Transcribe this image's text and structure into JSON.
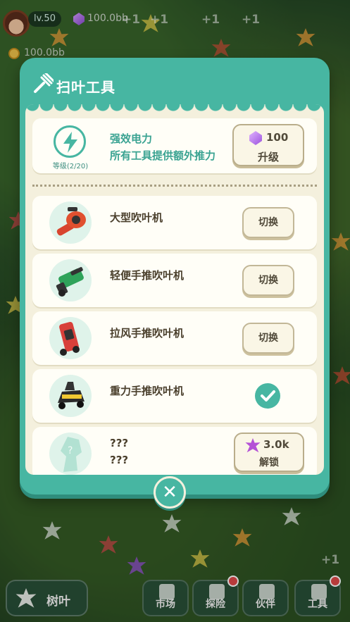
{
  "hud": {
    "level": "lv.50",
    "gems": "100.0bb",
    "coins": "100.0bb",
    "floating_bonus": "+1"
  },
  "modal": {
    "title": "扫叶工具",
    "upgrade": {
      "level_text": "等级(2/20)",
      "title": "强效电力",
      "description": "所有工具提供额外推力",
      "cost": "100",
      "button_label": "升级",
      "icon": "lightning-icon"
    },
    "tools": [
      {
        "name": "大型吹叶机",
        "action": "切换",
        "state": "available",
        "icon": "red-leaf-blower-icon"
      },
      {
        "name": "轻便手推吹叶机",
        "action": "切换",
        "state": "available",
        "icon": "green-push-blower-icon"
      },
      {
        "name": "拉风手推吹叶机",
        "action": "切换",
        "state": "available",
        "icon": "red-push-blower-icon"
      },
      {
        "name": "重力手推吹叶机",
        "action": "",
        "state": "selected",
        "icon": "black-push-blower-icon"
      }
    ],
    "locked_tool": {
      "name": "???",
      "subtitle": "???",
      "cost": "3.0k",
      "button_label": "解锁",
      "icon": "locked-silhouette-icon"
    },
    "close_icon": "close-icon"
  },
  "bottom_nav": {
    "leaves_label": "树叶",
    "items": [
      {
        "label": "市场",
        "icon": "scale-icon"
      },
      {
        "label": "探险",
        "icon": "explore-icon"
      },
      {
        "label": "伙伴",
        "icon": "cat-icon"
      },
      {
        "label": "工具",
        "icon": "rake-icon"
      }
    ]
  },
  "colors": {
    "accent": "#47b6a2",
    "panel": "#f4f0dd",
    "gem": "#9b52dd",
    "maple": "#b451d6"
  }
}
